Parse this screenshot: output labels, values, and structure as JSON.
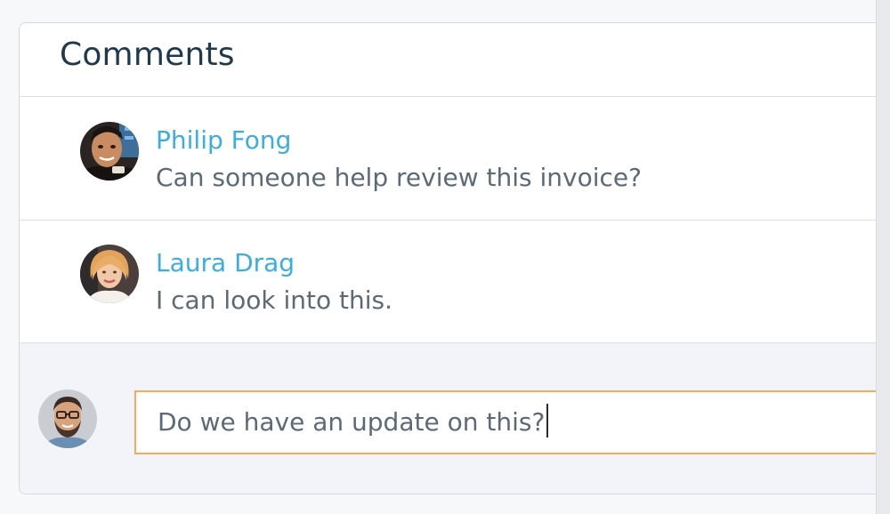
{
  "panel": {
    "title": "Comments"
  },
  "comments": [
    {
      "author": "Philip Fong",
      "text": "Can someone help review this invoice?",
      "avatar_icon": "avatar-philip-fong"
    },
    {
      "author": "Laura Drag",
      "text": "I can look into this.",
      "avatar_icon": "avatar-laura-drag"
    }
  ],
  "composer": {
    "value": "Do we have an update on this?",
    "avatar_icon": "avatar-current-user",
    "focus_color": "#f7a95c"
  },
  "colors": {
    "title": "#1e3a4c",
    "author": "#3aaee3",
    "body_text": "#5c6a77"
  }
}
